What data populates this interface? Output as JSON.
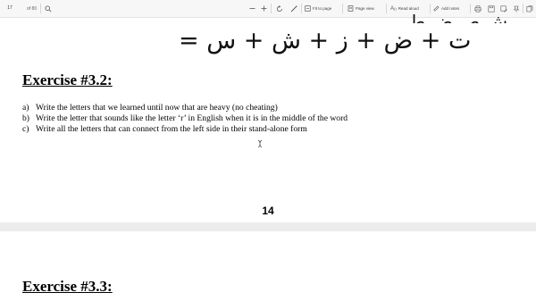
{
  "toolbar": {
    "page_current": "17",
    "page_total": "of 80",
    "fit_label": "Fit to page",
    "pageview_label": "Page view",
    "readaloud_label": "Read aloud",
    "addnotes_label": "Add notes"
  },
  "page1": {
    "arabic_top": "ش ص ض ط",
    "arabic_equation": "ت + ض + ز + ش + س =",
    "exercise_title": "Exercise #3.2:",
    "items": [
      {
        "marker": "a)",
        "text": "Write the letters that we learned until now that are heavy (no cheating)"
      },
      {
        "marker": "b)",
        "text": "Write the letter that sounds like the letter ‘r’ in English when it is in the middle of the word"
      },
      {
        "marker": "c)",
        "text": "Write all the letters that can connect from the left side in their stand-alone form"
      }
    ],
    "page_number": "14"
  },
  "page2": {
    "exercise_title": "Exercise #3.3:"
  },
  "icons": [
    "search-icon",
    "zoom-out-icon",
    "zoom-in-icon",
    "rotate-icon",
    "draw-icon",
    "fit-to-page-icon",
    "page-view-icon",
    "read-aloud-icon",
    "add-notes-icon",
    "print-icon",
    "save-icon",
    "save-as-icon",
    "pin-icon",
    "favorites-icon",
    "collections-icon"
  ]
}
